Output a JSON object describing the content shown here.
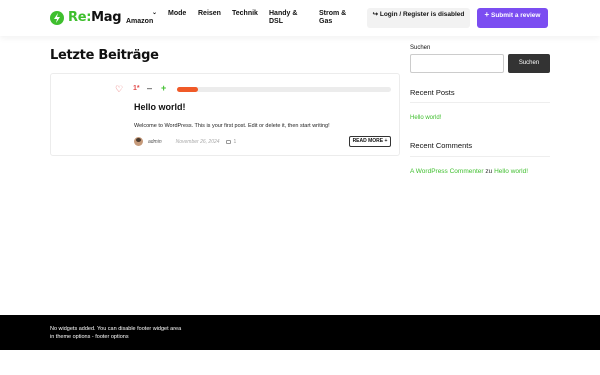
{
  "brand": {
    "part1": "Re:",
    "part2": "Mag",
    "accent": "#3fbf2e"
  },
  "nav": {
    "amazon": "Amazon",
    "mode": "Mode",
    "reisen": "Reisen",
    "technik": "Technik",
    "handy": "Handy & DSL",
    "strom": "Strom & Gas"
  },
  "header": {
    "login_label": "Login / Register is disabled",
    "submit_label": "Submit a review",
    "submit_color": "#7b4df1"
  },
  "main": {
    "page_title": "Letzte Beiträge",
    "post": {
      "score": "1*",
      "vote_fill": 0.1,
      "title": "Hello world!",
      "excerpt": "Welcome to WordPress. This is your first post. Edit or delete it, then start writing!",
      "author": "admin",
      "date": "November 26, 2024",
      "comments": "1",
      "readmore": "READ MORE +"
    }
  },
  "sidebar": {
    "search_label": "Suchen",
    "search_button": "Suchen",
    "recent_posts_title": "Recent Posts",
    "recent_post_link": "Hello world!",
    "recent_comments_title": "Recent Comments",
    "comment_author": "A WordPress Commenter",
    "comment_joiner": "zu",
    "comment_post": "Hello world!"
  },
  "footer": {
    "line1": "No widgets added. You can disable footer widget area",
    "line2": "in theme options - footer options"
  }
}
